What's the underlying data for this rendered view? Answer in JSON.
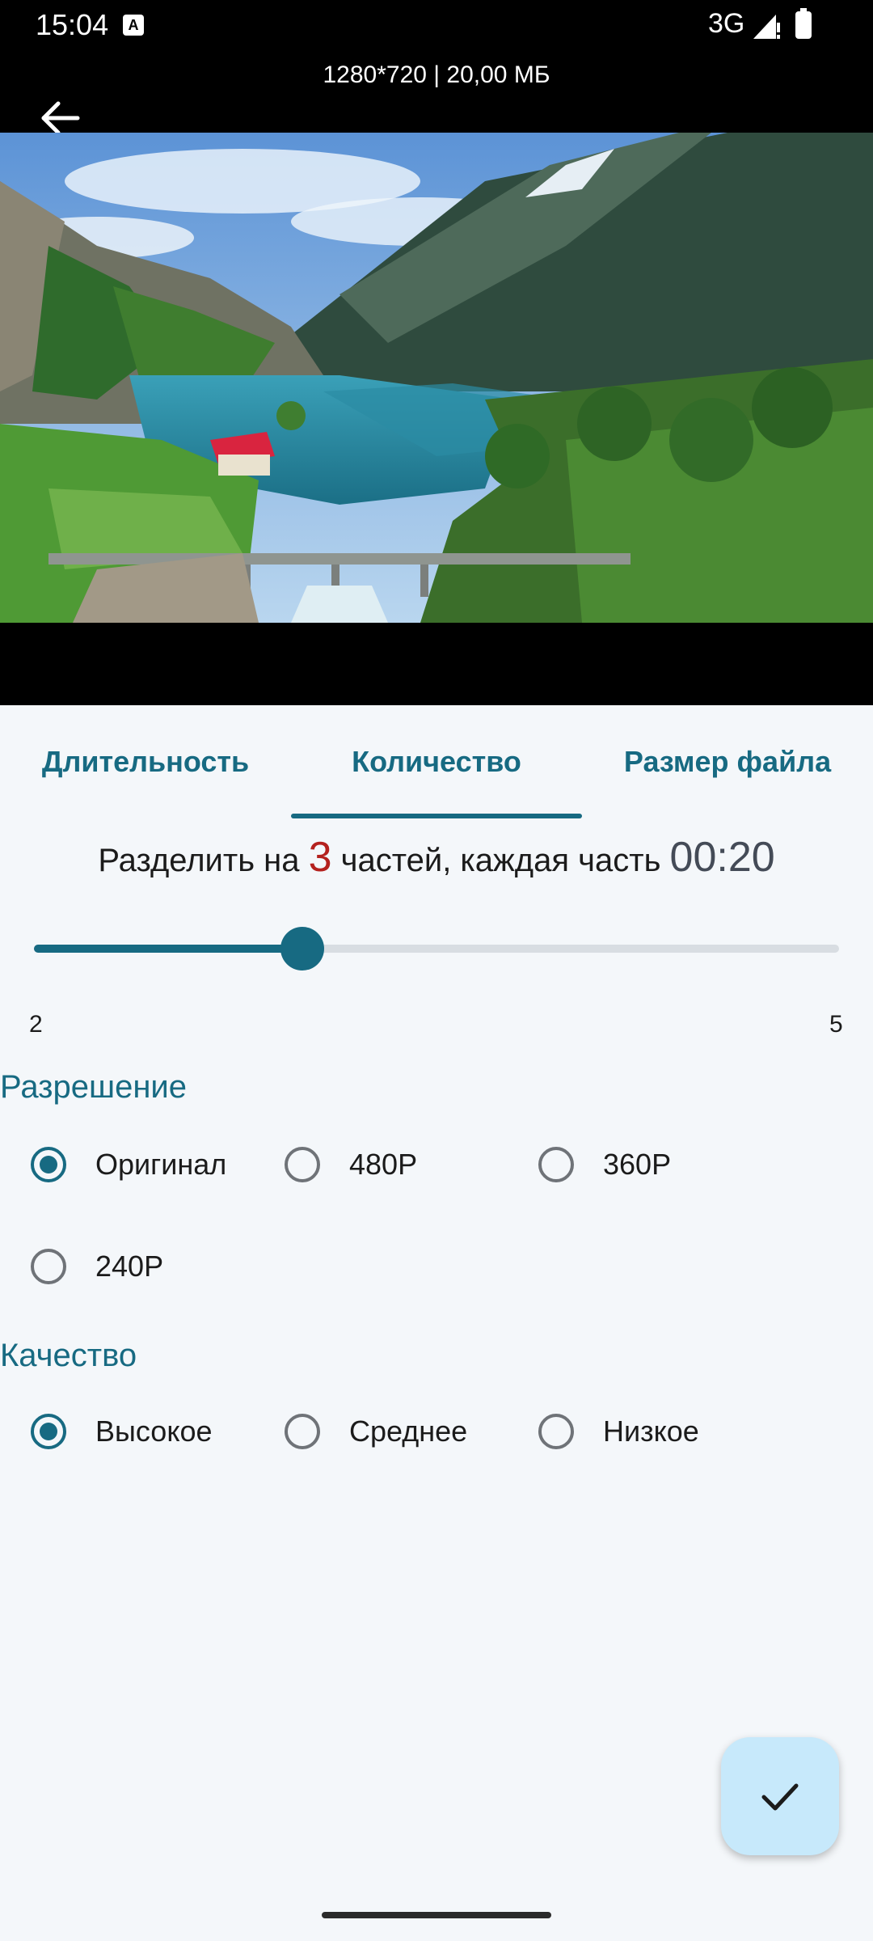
{
  "status_bar": {
    "time": "15:04",
    "network": "3G",
    "notification_icon": "A"
  },
  "video": {
    "info": "1280*720 | 20,00 МБ"
  },
  "tabs": [
    {
      "label": "Длительность"
    },
    {
      "label": "Количество"
    },
    {
      "label": "Размер файла"
    }
  ],
  "active_tab_index": 1,
  "split": {
    "prefix": "Разделить на ",
    "parts": "3",
    "middle": " частей, каждая часть ",
    "duration": "00:20"
  },
  "slider": {
    "min": "2",
    "max": "5",
    "value": 3
  },
  "resolution": {
    "title": "Разрешение",
    "options": [
      "Оригинал",
      "480P",
      "360P",
      "240P"
    ],
    "selected": "Оригинал"
  },
  "quality": {
    "title": "Качество",
    "options": [
      "Высокое",
      "Среднее",
      "Низкое"
    ],
    "selected": "Высокое"
  },
  "colors": {
    "accent": "#176a82",
    "highlight": "#b4211e",
    "fab_background": "#c7e9fb"
  },
  "icons": {
    "back": "arrow-left-icon",
    "confirm": "checkmark-icon"
  }
}
